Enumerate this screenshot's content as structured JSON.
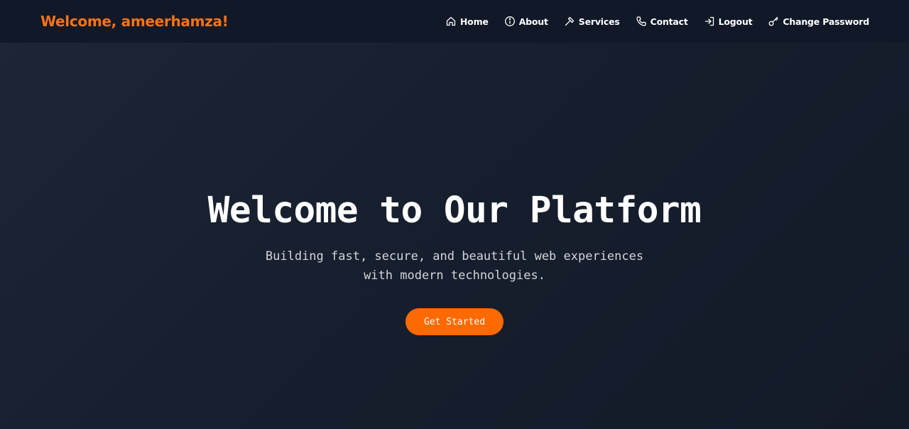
{
  "navbar": {
    "brand": "Welcome, ameerhamza!",
    "links": [
      {
        "label": "Home",
        "icon": "home-icon"
      },
      {
        "label": "About",
        "icon": "info-icon"
      },
      {
        "label": "Services",
        "icon": "hammer-icon"
      },
      {
        "label": "Contact",
        "icon": "phone-icon"
      },
      {
        "label": "Logout",
        "icon": "logout-icon"
      },
      {
        "label": "Change Password",
        "icon": "key-icon"
      }
    ]
  },
  "hero": {
    "title": "Welcome to Our Platform",
    "subtitle": "Building fast, secure, and beautiful web experiences with modern technologies.",
    "cta_label": "Get Started"
  },
  "colors": {
    "brand": "#f97316",
    "accent": "#ff6a00",
    "navbar_bg": "#111827",
    "page_bg": "#1a2233"
  }
}
